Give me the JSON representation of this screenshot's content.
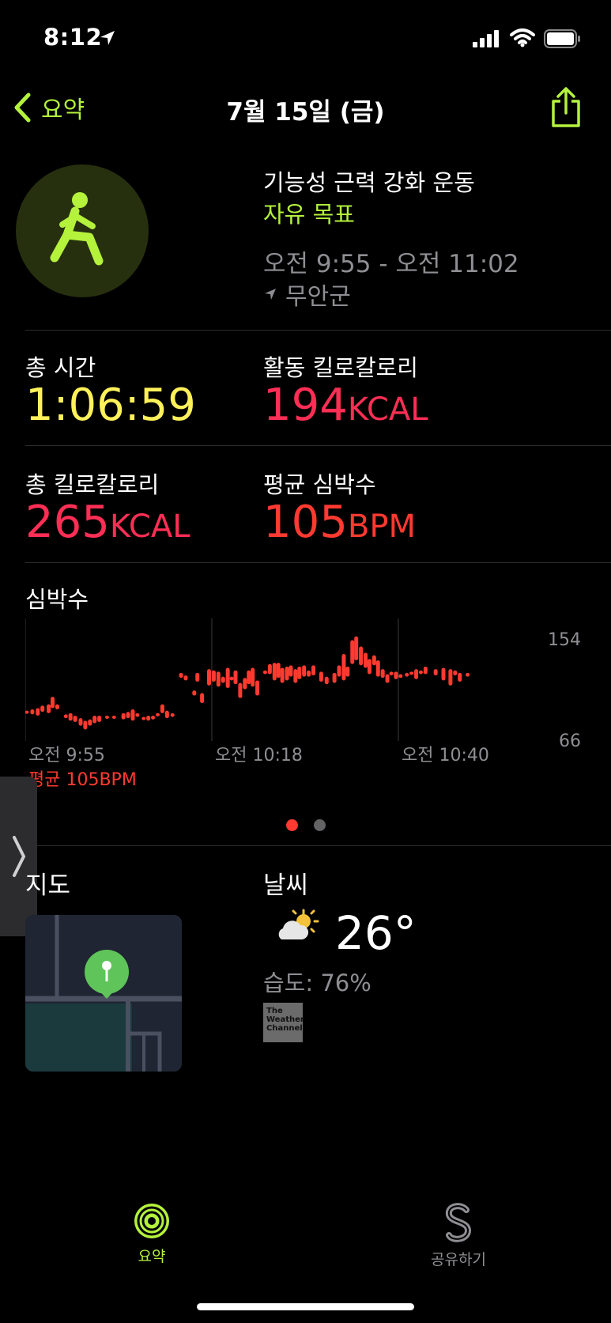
{
  "status_bar": {
    "time": "8:12"
  },
  "nav": {
    "back_label": "요약",
    "title": "7월 15일 (금)"
  },
  "workout": {
    "type": "기능성 근력 강화 운동",
    "goal": "자유 목표",
    "time_range": "오전 9:55 - 오전 11:02",
    "location": "무안군"
  },
  "metrics": {
    "total_time_label": "총 시간",
    "total_time_value": "1:06:59",
    "active_kcal_label": "활동 킬로칼로리",
    "active_kcal_value": "194",
    "active_kcal_unit": "KCAL",
    "total_kcal_label": "총 킬로칼로리",
    "total_kcal_value": "265",
    "total_kcal_unit": "KCAL",
    "avg_hr_label": "평균 심박수",
    "avg_hr_value": "105",
    "avg_hr_unit": "BPM"
  },
  "heart_rate": {
    "label": "심박수",
    "avg_text": "평균 105BPM",
    "y_max": "154",
    "y_min": "66",
    "x_ticks": [
      "오전 9:55",
      "오전 10:18",
      "오전 10:40"
    ],
    "color": "#ff3a30"
  },
  "chart_data": {
    "type": "bar",
    "title": "심박수",
    "xlabel": "",
    "ylabel": "",
    "x_tick_labels": [
      "오전 9:55",
      "오전 10:18",
      "오전 10:40"
    ],
    "ylim": [
      66,
      154
    ],
    "x_range_minutes": [
      0,
      67
    ],
    "series": [
      {
        "ranges": [
          [
            0.0,
            90,
            92
          ],
          [
            0.7,
            89,
            93
          ],
          [
            1.4,
            88,
            94
          ],
          [
            2.0,
            91,
            96
          ],
          [
            2.8,
            90,
            97
          ],
          [
            3.3,
            94,
            103
          ],
          [
            3.9,
            93,
            97
          ],
          [
            5.0,
            86,
            89
          ],
          [
            5.6,
            84,
            90
          ],
          [
            6.2,
            83,
            88
          ],
          [
            6.9,
            80,
            86
          ],
          [
            7.5,
            77,
            84
          ],
          [
            8.1,
            80,
            85
          ],
          [
            8.7,
            82,
            88
          ],
          [
            9.3,
            83,
            88
          ],
          [
            10.3,
            86,
            88
          ],
          [
            11.2,
            86,
            88
          ],
          [
            12.4,
            85,
            90
          ],
          [
            13.0,
            86,
            91
          ],
          [
            13.6,
            84,
            93
          ],
          [
            14.2,
            87,
            90
          ],
          [
            15.0,
            85,
            87
          ],
          [
            15.6,
            84,
            88
          ],
          [
            16.2,
            85,
            88
          ],
          [
            16.8,
            88,
            90
          ],
          [
            17.4,
            90,
            97
          ],
          [
            18.0,
            86,
            92
          ],
          [
            18.7,
            87,
            90
          ],
          [
            19.8,
            118,
            122
          ],
          [
            20.4,
            116,
            120
          ],
          [
            21.5,
            104,
            108
          ],
          [
            21.9,
            115,
            122
          ],
          [
            22.5,
            98,
            106
          ],
          [
            23.4,
            112,
            125
          ],
          [
            24.0,
            115,
            124
          ],
          [
            24.6,
            111,
            123
          ],
          [
            25.2,
            114,
            119
          ],
          [
            25.8,
            110,
            126
          ],
          [
            26.3,
            116,
            119
          ],
          [
            26.8,
            113,
            124
          ],
          [
            27.4,
            102,
            114
          ],
          [
            28.0,
            109,
            118
          ],
          [
            28.5,
            113,
            124
          ],
          [
            29.0,
            111,
            126
          ],
          [
            29.6,
            104,
            116
          ],
          [
            30.6,
            121,
            124
          ],
          [
            31.2,
            121,
            129
          ],
          [
            31.8,
            116,
            130
          ],
          [
            32.3,
            118,
            130
          ],
          [
            32.8,
            114,
            126
          ],
          [
            33.4,
            116,
            127
          ],
          [
            33.9,
            119,
            128
          ],
          [
            34.5,
            114,
            125
          ],
          [
            35.0,
            117,
            127
          ],
          [
            35.6,
            119,
            128
          ],
          [
            36.2,
            119,
            124
          ],
          [
            36.8,
            120,
            128
          ],
          [
            37.8,
            115,
            123
          ],
          [
            38.5,
            113,
            119
          ],
          [
            39.5,
            114,
            122
          ],
          [
            40.1,
            119,
            128
          ],
          [
            40.7,
            116,
            137
          ],
          [
            41.2,
            119,
            127
          ],
          [
            41.8,
            129,
            148
          ],
          [
            42.3,
            132,
            151
          ],
          [
            42.9,
            128,
            143
          ],
          [
            43.5,
            126,
            138
          ],
          [
            44.0,
            121,
            133
          ],
          [
            44.6,
            128,
            136
          ],
          [
            45.1,
            119,
            132
          ],
          [
            45.7,
            118,
            125
          ],
          [
            46.3,
            114,
            121
          ],
          [
            46.8,
            120,
            123
          ],
          [
            47.4,
            117,
            123
          ],
          [
            48.0,
            118,
            121
          ],
          [
            48.8,
            119,
            122
          ],
          [
            49.4,
            121,
            123
          ],
          [
            50.0,
            117,
            125
          ],
          [
            50.6,
            121,
            124
          ],
          [
            51.2,
            121,
            127
          ],
          [
            52.5,
            120,
            125
          ],
          [
            53.5,
            116,
            126
          ],
          [
            54.4,
            112,
            125
          ],
          [
            55.0,
            120,
            124
          ],
          [
            55.6,
            115,
            122
          ],
          [
            56.6,
            119,
            122
          ]
        ]
      }
    ]
  },
  "pager": {
    "dots": 2,
    "active": 0
  },
  "map_section": {
    "label": "지도"
  },
  "weather": {
    "label": "날씨",
    "temperature": "26°",
    "humidity": "습도: 76%",
    "provider_logo": "The Weather Channel"
  },
  "tabs": [
    {
      "label": "요약",
      "active": true
    },
    {
      "label": "공유하기",
      "active": false
    }
  ],
  "colors": {
    "accent": "#b4f23c",
    "yellow": "#fff15a",
    "pink": "#ff2e55",
    "orange": "#ff3a30"
  }
}
